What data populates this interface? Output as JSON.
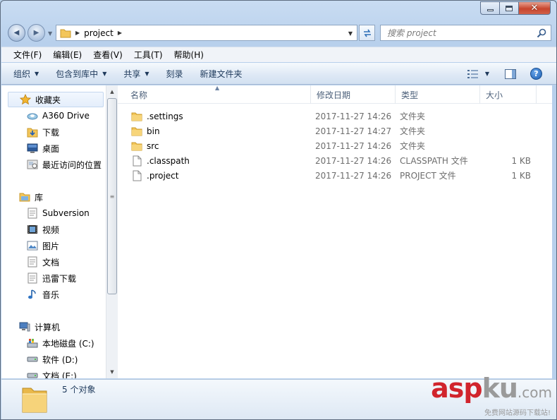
{
  "window": {
    "caption_minimize": "—",
    "caption_maximize": "□",
    "caption_close": "✕"
  },
  "navigation": {
    "back_glyph": "◀",
    "forward_glyph": "▶",
    "address_crumb": "project",
    "search_placeholder": "搜索 project"
  },
  "menubar": {
    "items": [
      "文件(F)",
      "编辑(E)",
      "查看(V)",
      "工具(T)",
      "帮助(H)"
    ]
  },
  "toolbar": {
    "organize": "组织",
    "include_in_library": "包含到库中",
    "share": "共享",
    "burn": "刻录",
    "new_folder": "新建文件夹"
  },
  "sidebar": {
    "favorites": {
      "label": "收藏夹",
      "items": [
        "A360 Drive",
        "下载",
        "桌面",
        "最近访问的位置"
      ]
    },
    "libraries": {
      "label": "库",
      "items": [
        "Subversion",
        "视频",
        "图片",
        "文档",
        "迅雷下载",
        "音乐"
      ]
    },
    "computer": {
      "label": "计算机",
      "items": [
        "本地磁盘 (C:)",
        "软件 (D:)",
        "文档 (E:)"
      ]
    }
  },
  "columns": {
    "name": "名称",
    "modified": "修改日期",
    "type": "类型",
    "size": "大小"
  },
  "files": [
    {
      "name": ".settings",
      "modified": "2017-11-27 14:26",
      "type": "文件夹",
      "size": "",
      "kind": "folder"
    },
    {
      "name": "bin",
      "modified": "2017-11-27 14:27",
      "type": "文件夹",
      "size": "",
      "kind": "folder"
    },
    {
      "name": "src",
      "modified": "2017-11-27 14:26",
      "type": "文件夹",
      "size": "",
      "kind": "folder"
    },
    {
      "name": ".classpath",
      "modified": "2017-11-27 14:26",
      "type": "CLASSPATH 文件",
      "size": "1 KB",
      "kind": "file"
    },
    {
      "name": ".project",
      "modified": "2017-11-27 14:26",
      "type": "PROJECT 文件",
      "size": "1 KB",
      "kind": "file"
    }
  ],
  "status": {
    "item_count": "5 个对象"
  },
  "watermark": {
    "red_part": "asp",
    "gray_part": "ku",
    "domain": ".com",
    "tagline": "免费网站源码下载站!"
  },
  "colors": {
    "accent": "#1e395b",
    "folder": "#f3c65a",
    "watermark_red": "#d1242c"
  }
}
